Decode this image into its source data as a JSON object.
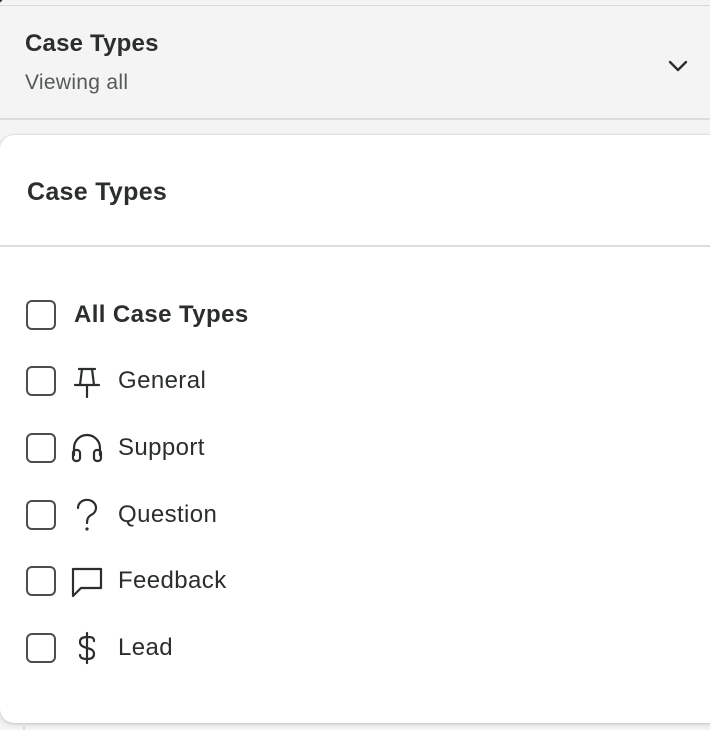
{
  "filter": {
    "title": "Case Types",
    "subtitle": "Viewing all",
    "toggle_icon": "chevron-down-icon"
  },
  "panel": {
    "title": "Case Types",
    "all_option": {
      "label": "All Case Types",
      "checked": false
    },
    "options": [
      {
        "label": "General",
        "icon": "pin-icon",
        "checked": false
      },
      {
        "label": "Support",
        "icon": "headset-icon",
        "checked": false
      },
      {
        "label": "Question",
        "icon": "question-mark-icon",
        "checked": false
      },
      {
        "label": "Feedback",
        "icon": "chat-bubble-icon",
        "checked": false
      },
      {
        "label": "Lead",
        "icon": "dollar-icon",
        "checked": false
      }
    ]
  },
  "colors": {
    "text": "#2b2f2c",
    "muted_text": "#555a56",
    "background": "#f3f4f3",
    "panel_background": "#ffffff",
    "divider": "#dcdedc"
  }
}
